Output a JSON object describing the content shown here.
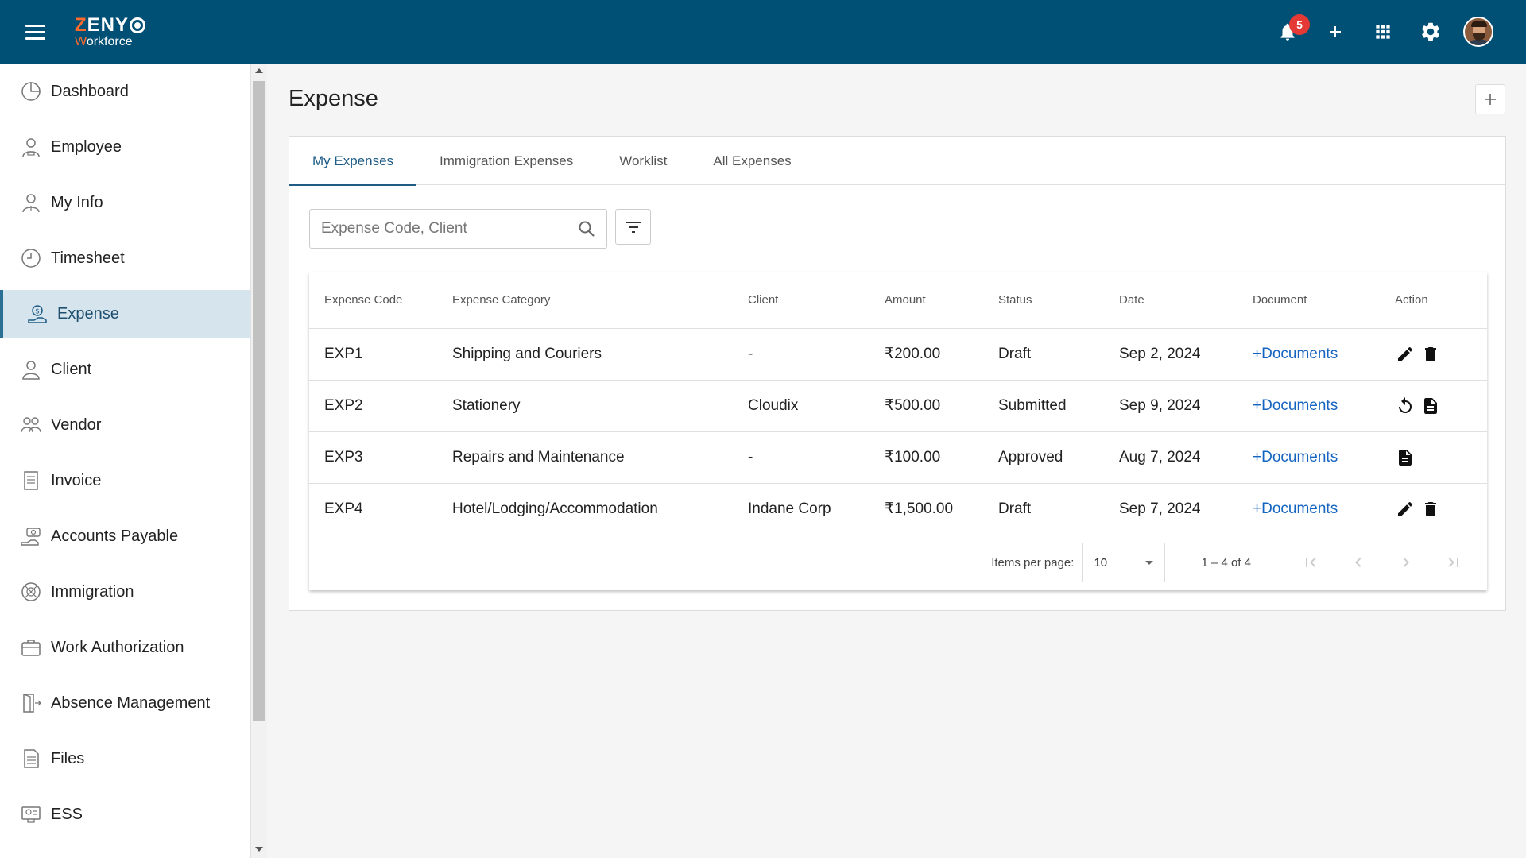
{
  "app": {
    "brand": "ZENY",
    "brand_sub": "Workforce",
    "notification_count": "5"
  },
  "sidebar": {
    "items": [
      {
        "label": "Dashboard",
        "icon": "dashboard-icon"
      },
      {
        "label": "Employee",
        "icon": "employee-icon"
      },
      {
        "label": "My Info",
        "icon": "my-info-icon"
      },
      {
        "label": "Timesheet",
        "icon": "clock-icon"
      },
      {
        "label": "Expense",
        "icon": "expense-icon",
        "active": true
      },
      {
        "label": "Client",
        "icon": "client-icon"
      },
      {
        "label": "Vendor",
        "icon": "vendor-icon"
      },
      {
        "label": "Invoice",
        "icon": "invoice-icon"
      },
      {
        "label": "Accounts Payable",
        "icon": "accounts-payable-icon"
      },
      {
        "label": "Immigration",
        "icon": "globe-icon"
      },
      {
        "label": "Work Authorization",
        "icon": "briefcase-icon"
      },
      {
        "label": "Absence Management",
        "icon": "door-exit-icon"
      },
      {
        "label": "Files",
        "icon": "files-icon"
      },
      {
        "label": "ESS",
        "icon": "ess-icon"
      }
    ]
  },
  "main": {
    "title": "Expense",
    "tabs": [
      {
        "label": "My Expenses",
        "active": true
      },
      {
        "label": "Immigration Expenses"
      },
      {
        "label": "Worklist"
      },
      {
        "label": "All Expenses"
      }
    ],
    "search_placeholder": "Expense Code, Client",
    "search_value": ""
  },
  "table": {
    "columns": [
      "Expense Code",
      "Expense Category",
      "Client",
      "Amount",
      "Status",
      "Date",
      "Document",
      "Action"
    ],
    "rows": [
      {
        "code": "EXP1",
        "category": "Shipping and Couriers",
        "client": "-",
        "amount": "₹200.00",
        "status": "Draft",
        "date": "Sep 2, 2024",
        "document": "+Documents",
        "actions": [
          "edit-icon",
          "delete-icon"
        ]
      },
      {
        "code": "EXP2",
        "category": "Stationery",
        "client": "Cloudix",
        "amount": "₹500.00",
        "status": "Submitted",
        "date": "Sep 9, 2024",
        "document": "+Documents",
        "actions": [
          "undo-icon",
          "document-icon"
        ]
      },
      {
        "code": "EXP3",
        "category": "Repairs and Maintenance",
        "client": "-",
        "amount": "₹100.00",
        "status": "Approved",
        "date": "Aug 7, 2024",
        "document": "+Documents",
        "actions": [
          "document-icon"
        ]
      },
      {
        "code": "EXP4",
        "category": "Hotel/Lodging/Accommodation",
        "client": "Indane Corp",
        "amount": "₹1,500.00",
        "status": "Draft",
        "date": "Sep 7, 2024",
        "document": "+Documents",
        "actions": [
          "edit-icon",
          "delete-icon"
        ]
      }
    ]
  },
  "pager": {
    "items_per_page_label": "Items per page:",
    "items_per_page": "10",
    "range": "1 – 4 of 4"
  },
  "colors": {
    "topbar": "#004f74",
    "accent": "#1e5c86",
    "link": "#1565c0",
    "active_nav": "#d6e4ee",
    "badge": "#e53935"
  }
}
